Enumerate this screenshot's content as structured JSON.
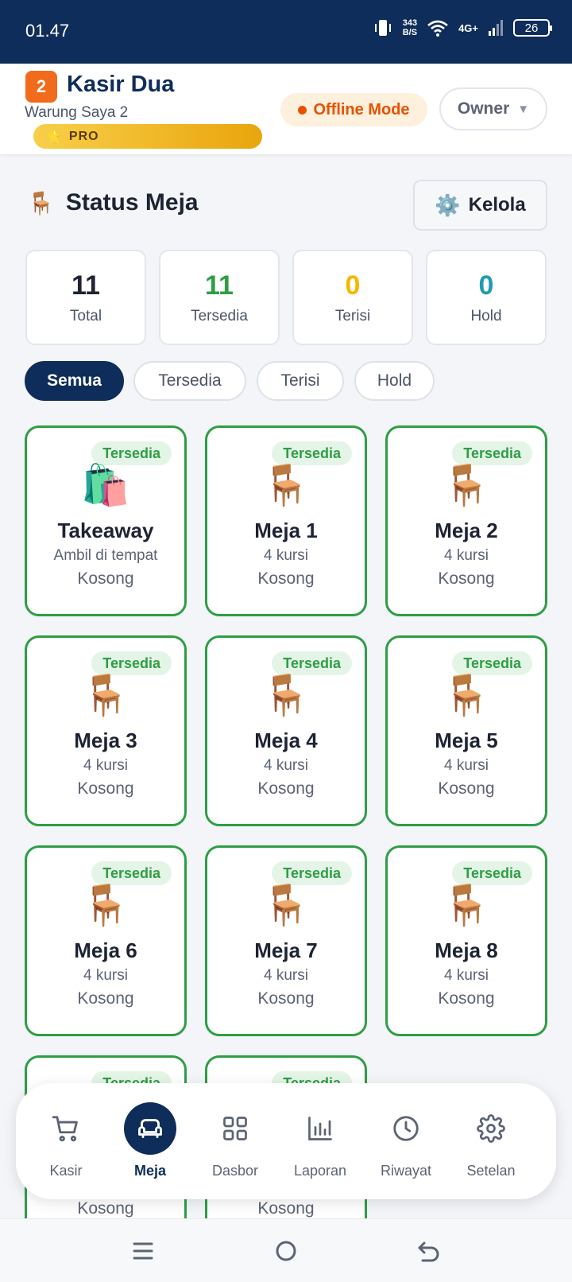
{
  "status_bar": {
    "time": "01.47",
    "speed_value": "343",
    "speed_unit": "B/S",
    "network": "4G+",
    "battery": "26"
  },
  "header": {
    "app_name": "Kasir Dua",
    "store_name": "Warung Saya 2",
    "plan_badge": "PRO",
    "offline_label": "Offline Mode",
    "role_label": "Owner",
    "accent_color": "#0f2d5a"
  },
  "section": {
    "title": "Status Meja",
    "manage_label": "Kelola"
  },
  "stats": [
    {
      "value": "11",
      "label": "Total",
      "color": "#1c2333"
    },
    {
      "value": "11",
      "label": "Tersedia",
      "color": "#2e9e45"
    },
    {
      "value": "0",
      "label": "Terisi",
      "color": "#f5b700"
    },
    {
      "value": "0",
      "label": "Hold",
      "color": "#1f9bb3"
    }
  ],
  "filters": [
    {
      "label": "Semua",
      "active": true
    },
    {
      "label": "Tersedia",
      "active": false
    },
    {
      "label": "Terisi",
      "active": false
    },
    {
      "label": "Hold",
      "active": false
    }
  ],
  "tables": [
    {
      "name": "Takeaway",
      "subtitle": "Ambil di tempat",
      "status": "Kosong",
      "badge": "Tersedia",
      "icon": "shopping-bags-icon"
    },
    {
      "name": "Meja 1",
      "subtitle": "4 kursi",
      "status": "Kosong",
      "badge": "Tersedia",
      "icon": "chair-icon"
    },
    {
      "name": "Meja 2",
      "subtitle": "4 kursi",
      "status": "Kosong",
      "badge": "Tersedia",
      "icon": "chair-icon"
    },
    {
      "name": "Meja 3",
      "subtitle": "4 kursi",
      "status": "Kosong",
      "badge": "Tersedia",
      "icon": "chair-icon"
    },
    {
      "name": "Meja 4",
      "subtitle": "4 kursi",
      "status": "Kosong",
      "badge": "Tersedia",
      "icon": "chair-icon"
    },
    {
      "name": "Meja 5",
      "subtitle": "4 kursi",
      "status": "Kosong",
      "badge": "Tersedia",
      "icon": "chair-icon"
    },
    {
      "name": "Meja 6",
      "subtitle": "4 kursi",
      "status": "Kosong",
      "badge": "Tersedia",
      "icon": "chair-icon"
    },
    {
      "name": "Meja 7",
      "subtitle": "4 kursi",
      "status": "Kosong",
      "badge": "Tersedia",
      "icon": "chair-icon"
    },
    {
      "name": "Meja 8",
      "subtitle": "4 kursi",
      "status": "Kosong",
      "badge": "Tersedia",
      "icon": "chair-icon"
    },
    {
      "badge": "Tersedia",
      "status": "Kosong"
    },
    {
      "badge": "Tersedia",
      "status": "Kosong"
    }
  ],
  "nav": [
    {
      "label": "Kasir",
      "icon": "cart-icon",
      "active": false
    },
    {
      "label": "Meja",
      "icon": "sofa-icon",
      "active": true
    },
    {
      "label": "Dasbor",
      "icon": "grid-icon",
      "active": false
    },
    {
      "label": "Laporan",
      "icon": "bar-chart-icon",
      "active": false
    },
    {
      "label": "Riwayat",
      "icon": "clock-icon",
      "active": false
    },
    {
      "label": "Setelan",
      "icon": "gear-icon",
      "active": false
    }
  ]
}
